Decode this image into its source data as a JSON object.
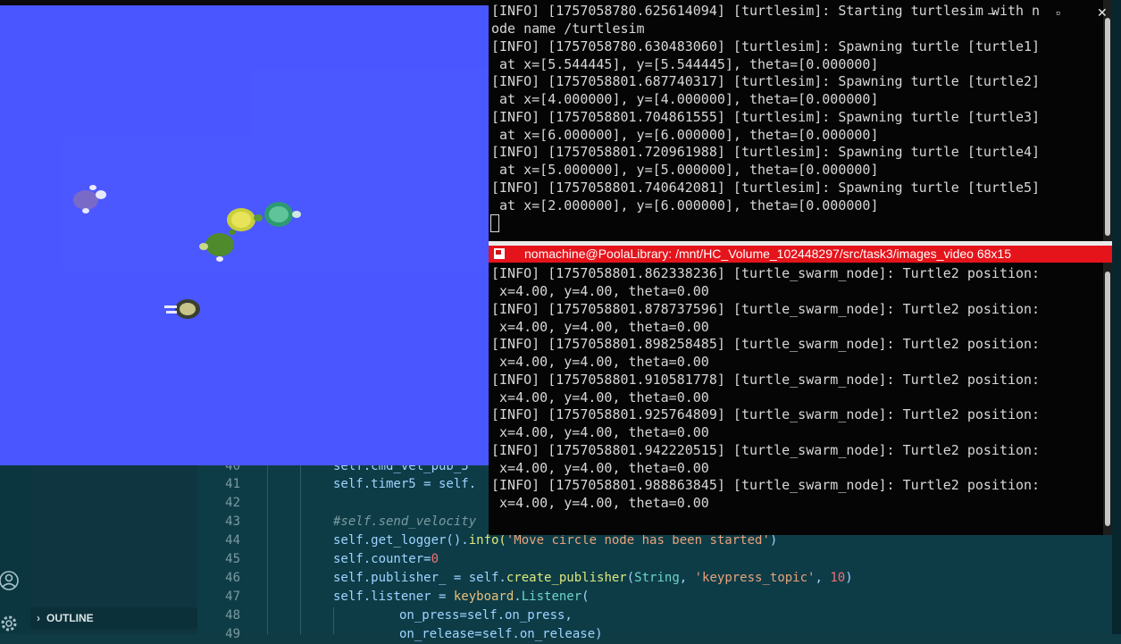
{
  "editor": {
    "line_numbers": [
      "40",
      "41",
      "42",
      "43",
      "44",
      "45",
      "46",
      "47",
      "48",
      "49"
    ],
    "outline_label": "OUTLINE",
    "lines": {
      "l40": "self.cmd_vel_pub_5",
      "l41": "self.timer5 = self.",
      "l43": "#self.send_velocity",
      "l44a": "self.get_logger().",
      "l44b": "info(",
      "l44c": "'Move circle node has been started'",
      "l44d": ")",
      "l45a": "self.counter=",
      "l45b": "0",
      "l46a": "self.publisher_ = self.",
      "l46b": "create_publisher",
      "l46c": "(",
      "l46d": "String",
      "l46e": ", ",
      "l46f": "'keypress_topic'",
      "l46g": ", ",
      "l46h": "10",
      "l46i": ")",
      "l47a": "self.listener = ",
      "l47b": "keyboard",
      "l47c": ".",
      "l47d": "Listener",
      "l47e": "(",
      "l48": "on_press=self.on_press,",
      "l49": "on_release=self.on_release)"
    }
  },
  "terminal_top": {
    "lines": [
      "[INFO] [1757058780.625614094] [turtlesim]: Starting turtlesim with n",
      "ode name /turtlesim",
      "[INFO] [1757058780.630483060] [turtlesim]: Spawning turtle [turtle1]",
      " at x=[5.544445], y=[5.544445], theta=[0.000000]",
      "[INFO] [1757058801.687740317] [turtlesim]: Spawning turtle [turtle2]",
      " at x=[4.000000], y=[4.000000], theta=[0.000000]",
      "[INFO] [1757058801.704861555] [turtlesim]: Spawning turtle [turtle3]",
      " at x=[6.000000], y=[6.000000], theta=[0.000000]",
      "[INFO] [1757058801.720961988] [turtlesim]: Spawning turtle [turtle4]",
      " at x=[5.000000], y=[5.000000], theta=[0.000000]",
      "[INFO] [1757058801.740642081] [turtlesim]: Spawning turtle [turtle5]",
      " at x=[2.000000], y=[6.000000], theta=[0.000000]"
    ],
    "window_controls": {
      "minimize": "–",
      "maximize": "▫",
      "close": "✕"
    }
  },
  "terminal_bottom": {
    "title": "nomachine@PoolaLibrary: /mnt/HC_Volume_102448297/src/task3/images_video 68x15",
    "lines": [
      "[INFO] [1757058801.862338236] [turtle_swarm_node]: Turtle2 position:",
      " x=4.00, y=4.00, theta=0.00",
      "[INFO] [1757058801.878737596] [turtle_swarm_node]: Turtle2 position:",
      " x=4.00, y=4.00, theta=0.00",
      "[INFO] [1757058801.898258485] [turtle_swarm_node]: Turtle2 position:",
      " x=4.00, y=4.00, theta=0.00",
      "[INFO] [1757058801.910581778] [turtle_swarm_node]: Turtle2 position:",
      " x=4.00, y=4.00, theta=0.00",
      "[INFO] [1757058801.925764809] [turtle_swarm_node]: Turtle2 position:",
      " x=4.00, y=4.00, theta=0.00",
      "[INFO] [1757058801.942220515] [turtle_swarm_node]: Turtle2 position:",
      " x=4.00, y=4.00, theta=0.00",
      "[INFO] [1757058801.988863845] [turtle_swarm_node]: Turtle2 position:",
      " x=4.00, y=4.00, theta=0.00"
    ]
  },
  "turtlesim": {
    "background_color": "#4a56ff",
    "turtles": [
      "turtle1",
      "turtle2",
      "turtle3",
      "turtle4",
      "turtle5"
    ]
  },
  "colors": {
    "terminal_title_bar": "#e5141b",
    "editor_bg": "#0d3c47"
  }
}
